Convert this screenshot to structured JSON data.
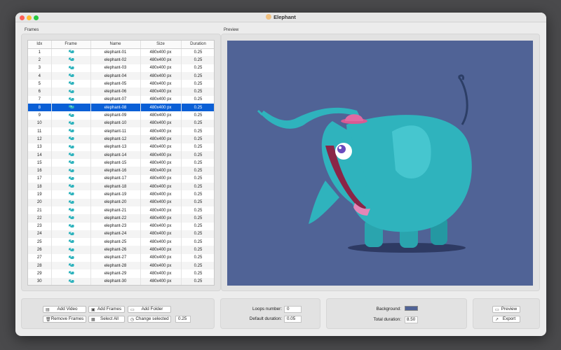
{
  "window": {
    "title": "Elephant"
  },
  "sections": {
    "frames": "Frames",
    "preview": "Preview"
  },
  "table": {
    "columns": [
      "Idx",
      "Frame",
      "Name",
      "Size",
      "Duration"
    ],
    "selected_index": 8,
    "rows": [
      {
        "idx": "1",
        "name": "elephant-01",
        "size": "480x400 px",
        "duration": "0.25"
      },
      {
        "idx": "2",
        "name": "elephant-02",
        "size": "480x400 px",
        "duration": "0.25"
      },
      {
        "idx": "3",
        "name": "elephant-03",
        "size": "480x400 px",
        "duration": "0.25"
      },
      {
        "idx": "4",
        "name": "elephant-04",
        "size": "480x400 px",
        "duration": "0.25"
      },
      {
        "idx": "5",
        "name": "elephant-05",
        "size": "480x400 px",
        "duration": "0.25"
      },
      {
        "idx": "6",
        "name": "elephant-06",
        "size": "480x400 px",
        "duration": "0.25"
      },
      {
        "idx": "7",
        "name": "elephant-07",
        "size": "480x400 px",
        "duration": "0.25"
      },
      {
        "idx": "8",
        "name": "elephant-08",
        "size": "480x400 px",
        "duration": "0.25"
      },
      {
        "idx": "9",
        "name": "elephant-09",
        "size": "480x400 px",
        "duration": "0.25"
      },
      {
        "idx": "10",
        "name": "elephant-10",
        "size": "480x400 px",
        "duration": "0.25"
      },
      {
        "idx": "11",
        "name": "elephant-11",
        "size": "480x400 px",
        "duration": "0.25"
      },
      {
        "idx": "12",
        "name": "elephant-12",
        "size": "480x400 px",
        "duration": "0.25"
      },
      {
        "idx": "13",
        "name": "elephant-13",
        "size": "480x400 px",
        "duration": "0.25"
      },
      {
        "idx": "14",
        "name": "elephant-14",
        "size": "480x400 px",
        "duration": "0.25"
      },
      {
        "idx": "15",
        "name": "elephant-15",
        "size": "480x400 px",
        "duration": "0.25"
      },
      {
        "idx": "16",
        "name": "elephant-16",
        "size": "480x400 px",
        "duration": "0.25"
      },
      {
        "idx": "17",
        "name": "elephant-17",
        "size": "480x400 px",
        "duration": "0.25"
      },
      {
        "idx": "18",
        "name": "elephant-18",
        "size": "480x400 px",
        "duration": "0.25"
      },
      {
        "idx": "19",
        "name": "elephant-19",
        "size": "480x400 px",
        "duration": "0.25"
      },
      {
        "idx": "20",
        "name": "elephant-20",
        "size": "480x400 px",
        "duration": "0.25"
      },
      {
        "idx": "21",
        "name": "elephant-21",
        "size": "480x400 px",
        "duration": "0.25"
      },
      {
        "idx": "22",
        "name": "elephant-22",
        "size": "480x400 px",
        "duration": "0.25"
      },
      {
        "idx": "23",
        "name": "elephant-23",
        "size": "480x400 px",
        "duration": "0.25"
      },
      {
        "idx": "24",
        "name": "elephant-24",
        "size": "480x400 px",
        "duration": "0.25"
      },
      {
        "idx": "25",
        "name": "elephant-25",
        "size": "480x400 px",
        "duration": "0.25"
      },
      {
        "idx": "26",
        "name": "elephant-26",
        "size": "480x400 px",
        "duration": "0.25"
      },
      {
        "idx": "27",
        "name": "elephant-27",
        "size": "480x400 px",
        "duration": "0.25"
      },
      {
        "idx": "28",
        "name": "elephant-28",
        "size": "480x400 px",
        "duration": "0.25"
      },
      {
        "idx": "29",
        "name": "elephant-29",
        "size": "480x400 px",
        "duration": "0.25"
      },
      {
        "idx": "30",
        "name": "elephant-30",
        "size": "480x400 px",
        "duration": "0.25"
      }
    ]
  },
  "frame_controls": {
    "add_video": "Add Video",
    "add_frames": "Add Frames",
    "add_folder": "Add Folder",
    "remove_frames": "Remove Frames",
    "select_all": "Select All",
    "change_selected": "Change selected",
    "change_value": "0.25"
  },
  "timing": {
    "loops_label": "Loops number:",
    "loops_value": "0",
    "default_duration_label": "Default duration:",
    "default_duration_value": "0.05"
  },
  "output": {
    "background_label": "Background:",
    "background_color": "#506396",
    "total_duration_label": "Total duration:",
    "total_duration_value": "8.50"
  },
  "actions": {
    "preview": "Preview",
    "export": "Export"
  },
  "colors": {
    "selection": "#0a5fd6",
    "canvas": "#506396",
    "elephant": "#2fb3bd"
  },
  "icons": [
    "film-icon",
    "images-icon",
    "folder-icon",
    "trash-icon",
    "grid-icon",
    "clock-icon",
    "video-icon",
    "export-icon"
  ]
}
